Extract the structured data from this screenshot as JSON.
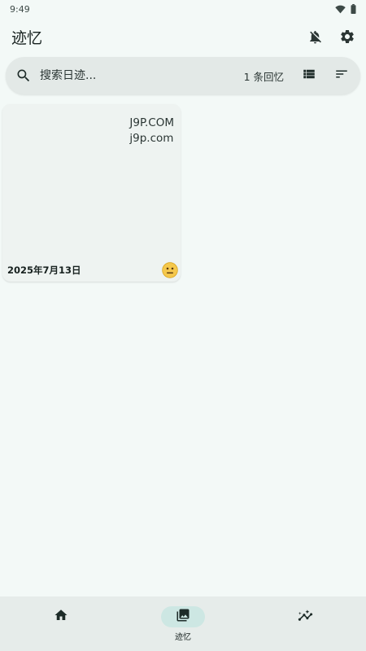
{
  "status_bar": {
    "time": "9:49",
    "icons": [
      "wifi-icon",
      "battery-icon"
    ]
  },
  "app_bar": {
    "title": "迹忆",
    "actions": [
      "notifications-off-icon",
      "settings-icon"
    ]
  },
  "search": {
    "placeholder": "搜索日迹...",
    "count_label": "1 条回忆",
    "buttons": [
      "view-list-icon",
      "sort-icon"
    ]
  },
  "entries": [
    {
      "text_line1": "J9P.COM",
      "text_line2": "j9p.com",
      "date": "2025年7月13日",
      "mood": "neutral-face-icon"
    }
  ],
  "bottom_nav": {
    "items": [
      {
        "icon": "home-icon",
        "label": "",
        "active": false
      },
      {
        "icon": "photo-library-icon",
        "label": "迹忆",
        "active": true
      },
      {
        "icon": "insights-icon",
        "label": "",
        "active": false
      }
    ]
  },
  "colors": {
    "background": "#f3f9f7",
    "search_bar": "#e3e9e7",
    "card": "#eef3f1",
    "nav_bar": "#e6ecea",
    "nav_active_pill": "#cde7e3",
    "mood_face": "#f5c84c"
  }
}
